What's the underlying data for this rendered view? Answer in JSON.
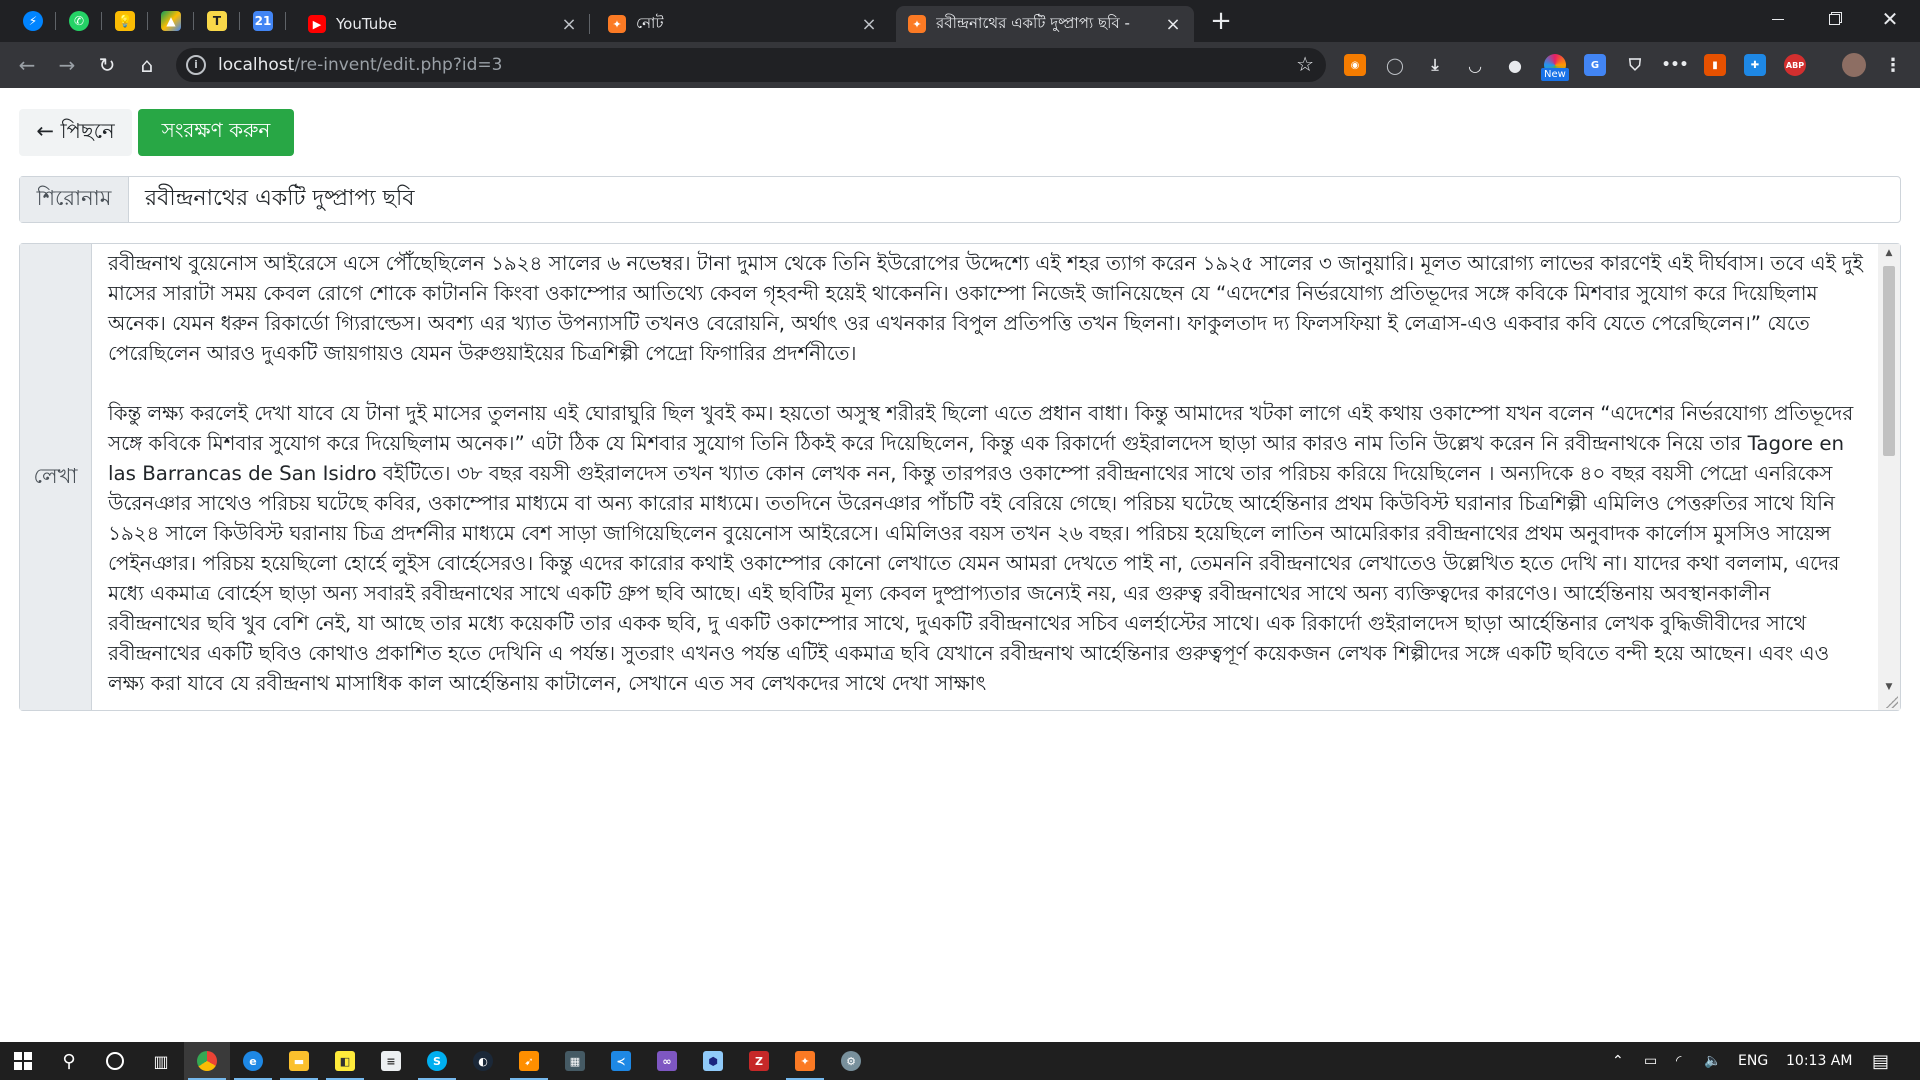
{
  "browser": {
    "tabs": [
      {
        "title": "YouTube"
      },
      {
        "title": "নোট"
      },
      {
        "title": "রবীন্দ্রনাথের একটি দুষ্প্রাপ্য ছবি - "
      }
    ],
    "pinned_badges": {
      "calendar": "21"
    },
    "url": {
      "host": "localhost",
      "path": "/re-invent/edit.php?id=3"
    },
    "ext_badge": "New",
    "ext_labels": {
      "abp": "ABP"
    }
  },
  "page": {
    "back_label": "← পিছনে",
    "save_label": "সংরক্ষণ করুন",
    "title_label": "শিরোনাম",
    "title_value": "রবীন্দ্রনাথের একটি দুষ্প্রাপ্য ছবি",
    "body_label": "লেখা",
    "body_text": "রবীন্দ্রনাথ বুয়েনোস আইরেসে এসে পৌঁছেছিলেন ১৯২৪ সালের ৬ নভেম্বর। টানা দুমাস থেকে তিনি ইউরোপের উদ্দেশ্যে এই শহর ত্যাগ করেন ১৯২৫ সালের ৩ জানুয়ারি। মূলত আরোগ্য লাভের কারণেই এই দীর্ঘবাস। তবে এই দুই মাসের সারাটা সময় কেবল রোগে শোকে কাটাননি কিংবা ওকাম্পোর আতিথ্যে কেবল গৃহবন্দী হয়েই থাকেননি। ওকাম্পো নিজেই জানিয়েছেন যে “এদেশের নির্ভরযোগ্য প্রতিভূদের সঙ্গে কবিকে মিশবার সুযোগ করে দিয়েছিলাম অনেক। যেমন ধরুন রিকার্ডো গ্যিরাল্ডেস। অবশ্য এর খ্যাত উপন্যাসটি তখনও বেরোয়নি, অর্থাৎ ওর এখনকার বিপুল প্রতিপত্তি তখন ছিলনা। ফাকুলতাদ দ্য ফিলসফিয়া ই লেত্রাস-এও একবার কবি যেতে পেরেছিলেন।” যেতে পেরেছিলেন আরও দুএকটি জায়গায়ও যেমন উরুগুয়াইয়ের চিত্রশিল্পী পেদ্রো ফিগারির প্রদর্শনীতে।\n\nকিন্তু লক্ষ্য করলেই দেখা যাবে যে টানা দুই মাসের তুলনায় এই ঘোরাঘুরি ছিল খুবই কম। হয়তো অসুস্থ শরীরই ছিলো এতে প্রধান বাধা। কিন্তু আমাদের খটকা লাগে এই কথায় ওকাম্পো যখন বলেন “এদেশের নির্ভরযোগ্য প্রতিভূদের সঙ্গে কবিকে মিশবার সুযোগ করে দিয়েছিলাম অনেক।” এটা ঠিক যে মিশবার সুযোগ তিনি ঠিকই করে দিয়েছিলেন, কিন্তু এক রিকার্দো গুইরালদেস ছাড়া আর কারও নাম তিনি উল্লেখ করেন নি রবীন্দ্রনাথকে নিয়ে তার Tagore en las Barrancas de San Isidro বইটিতে। ৩৮ বছর বয়সী গুইরালদেস তখন খ্যাত কোন লেখক নন, কিন্তু তারপরও ওকাম্পো রবীন্দ্রনাথের সাথে তার পরিচয় করিয়ে দিয়েছিলেন । অন্যদিকে ৪০ বছর বয়সী পেদ্রো এনরিকেস উরেনঞার সাথেও পরিচয় ঘটেছে কবির, ওকাম্পোর মাধ্যমে বা অন্য কারোর মাধ্যমে। ততদিনে উরেনঞার পাঁচটি বই বেরিয়ে গেছে। পরিচয় ঘটেছে আর্হেন্তিনার প্রথম কিউবিস্ট ঘরানার চিত্রশিল্পী এমিলিও পেত্তরুতির সাথে যিনি ১৯২৪ সালে কিউবিস্ট ঘরানায় চিত্র প্রদর্শনীর মাধ্যমে বেশ সাড়া জাগিয়েছিলেন বুয়েনোস আইরেসে। এমিলিওর বয়স তখন ২৬ বছর। পরিচয় হয়েছিলে লাতিন আমেরিকার রবীন্দ্রনাথের প্রথম অনুবাদক কার্লোস মুসসিও সায়েন্স পেইনঞার। পরিচয় হয়েছিলো হোর্হে লুইস বোর্হেসেরও। কিন্তু এদের কারোর কথাই ওকাম্পোর কোনো লেখাতে যেমন আমরা দেখতে পাই না, তেমননি রবীন্দ্রনাথের লেখাতেও উল্লেখিত হতে দেখি না। যাদের কথা বললাম, এদের মধ্যে একমাত্র বোর্হেস ছাড়া অন্য সবারই রবীন্দ্রনাথের সাথে একটি গ্রুপ ছবি আছে। এই ছবিটির মূল্য কেবল দুষ্প্রাপ্যতার জন্যেই নয়, এর গুরুত্ব রবীন্দ্রনাথের সাথে অন্য ব্যক্তিত্বদের কারণেও। আর্হেন্তিনায় অবস্থানকালীন রবীন্দ্রনাথের ছবি খুব বেশি নেই, যা আছে তার মধ্যে কয়েকটি তার একক ছবি, দু একটি ওকাম্পোর সাথে, দুএকটি রবীন্দ্রনাথের সচিব এলর্হাস্টের সাথে। এক রিকার্দো গুইরালদেস ছাড়া আর্হেন্তিনার লেখক বুদ্ধিজীবীদের সাথে রবীন্দ্রনাথের একটি ছবিও কোথাও প্রকাশিত হতে দেখিনি এ পর্যন্ত। সুতরাং এখনও পর্যন্ত এটিই একমাত্র ছবি যেখানে রবীন্দ্রনাথ আর্হেন্তিনার গুরুত্বপূর্ণ কয়েকজন লেখক শিল্পীদের সঙ্গে একটি ছবিতে বন্দী হয়ে আছেন। এবং এও লক্ষ্য করা যাবে যে রবীন্দ্রনাথ মাসাধিক কাল আর্হেন্তিনায় কাটালেন, সেখানে এত সব লেখকদের সাথে দেখা সাক্ষাৎ"
  },
  "taskbar": {
    "language": "ENG",
    "time": "10:13 AM"
  },
  "colors": {
    "tabstrip": "#202124",
    "toolbar": "#35363a",
    "save_button": "#28a745",
    "taskbar": "#1f1f1f"
  },
  "icons": {
    "pinned": [
      "messenger-icon",
      "whatsapp-icon",
      "keep-icon",
      "drive-icon",
      "typing-icon",
      "calendar-icon"
    ],
    "extensions": [
      "rss-icon",
      "bulb-icon",
      "download-icon",
      "pocket-icon",
      "eye-icon",
      "new-ext-icon",
      "translate-icon",
      "shield-icon",
      "dots-ext-icon",
      "office-icon",
      "snip-icon",
      "adblock-icon",
      "profile-avatar",
      "menu-icon"
    ],
    "taskbar": [
      "windows-start-icon",
      "search-icon",
      "cortana-icon",
      "task-view-icon",
      "chrome-icon",
      "edge-icon",
      "explorer-icon",
      "sticky-icon",
      "notepad-icon",
      "skype-icon",
      "steam-icon",
      "cursor-tool-icon",
      "calculator-icon",
      "vscode-icon",
      "visual-studio-icon",
      "box-icon",
      "filezilla-icon",
      "xampp-icon",
      "settings-gear-icon"
    ]
  }
}
